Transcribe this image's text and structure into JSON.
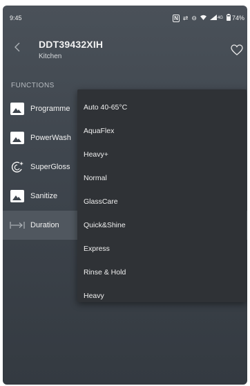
{
  "status": {
    "time": "9:45",
    "network": "4G",
    "battery": "74%"
  },
  "header": {
    "title": "DDT39432XIH",
    "subtitle": "Kitchen"
  },
  "section_label": "FUNCTIONS",
  "functions": [
    {
      "label": "Programme",
      "icon": "image-icon"
    },
    {
      "label": "PowerWash",
      "icon": "image-icon"
    },
    {
      "label": "SuperGloss",
      "icon": "supergloss-icon"
    },
    {
      "label": "Sanitize",
      "icon": "image-icon"
    },
    {
      "label": "Duration",
      "icon": "duration-arrow-icon"
    }
  ],
  "programme_options": [
    "Auto 40-65°C",
    "AquaFlex",
    "Heavy+",
    "Normal",
    "GlassCare",
    "Quick&Shine",
    "Express",
    "Rinse & Hold",
    "Heavy"
  ]
}
